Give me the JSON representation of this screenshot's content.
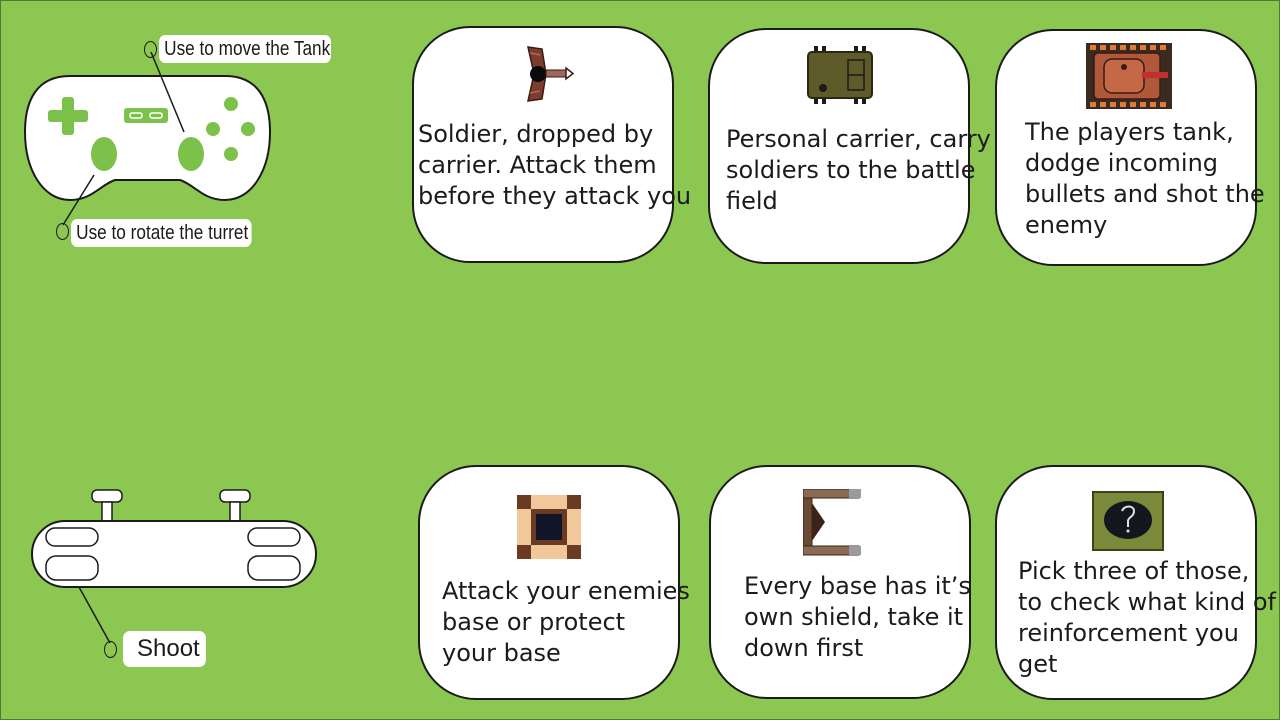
{
  "controls": {
    "move_label": "Use to move the Tank",
    "rotate_label": "Use to rotate the turret",
    "shoot_label": "Shoot"
  },
  "cards": [
    {
      "text": "Soldier, dropped by\ncarrier. Attack them\nbefore they attack you",
      "icon": "soldier-icon"
    },
    {
      "text": "Personal carrier, carry\nsoldiers to the battle\nfield",
      "icon": "carrier-icon"
    },
    {
      "text": "The players tank,\ndodge incoming\nbullets and shot the\nenemy",
      "icon": "player-tank-icon"
    },
    {
      "text": "Attack your enemies\n base or protect\n your base",
      "icon": "enemy-base-icon"
    },
    {
      "text": "Every base has it’s\nown shield, take it\ndown first",
      "icon": "shield-icon"
    },
    {
      "text": "Pick three of those,\nto check what kind of\nreinforcement you\nget",
      "icon": "reinforcement-icon"
    }
  ],
  "colors": {
    "background": "#8bc751",
    "accent": "#7cc24a",
    "outline": "#1b1b1b"
  }
}
